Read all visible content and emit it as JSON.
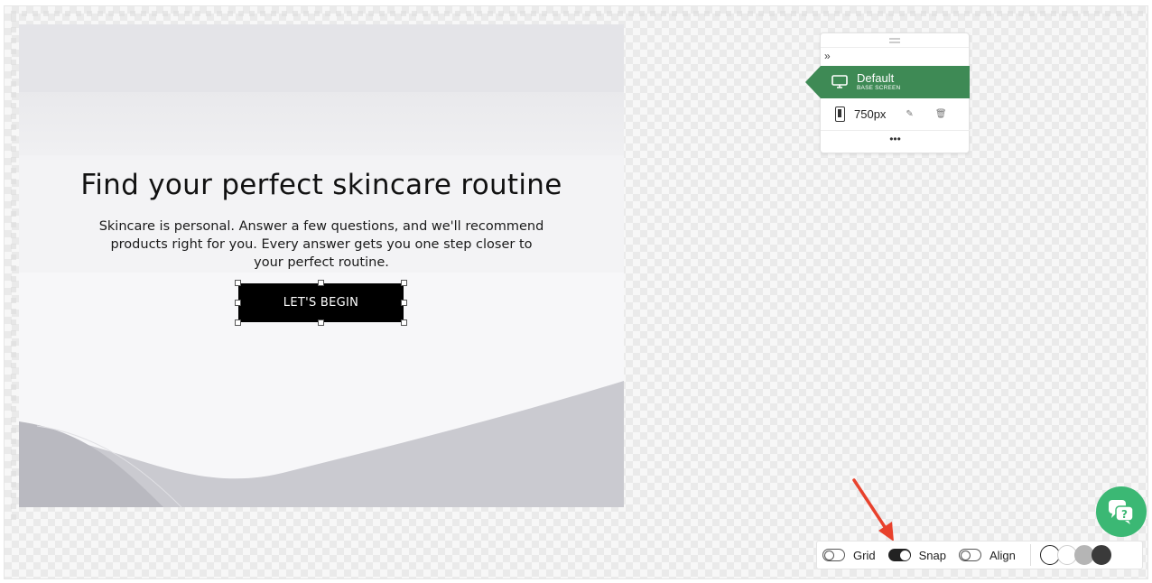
{
  "canvas": {
    "title": "Find your perfect skincare routine",
    "description": "Skincare is personal. Answer a few questions, and we'll recommend products right for you. Every answer gets you one step closer to your perfect routine.",
    "cta_label": "LET'S BEGIN"
  },
  "breakpoints": {
    "expand_glyph": "»",
    "default": {
      "label": "Default",
      "sublabel": "BASE SCREEN",
      "icon": "monitor-icon"
    },
    "items": [
      {
        "label": "750px",
        "icon": "phone-icon",
        "actions": [
          "edit-icon",
          "trash-icon"
        ]
      }
    ],
    "more_glyph": "•••"
  },
  "toolbar": {
    "grid_label": "Grid",
    "grid_on": false,
    "snap_label": "Snap",
    "snap_on": true,
    "align_label": "Align",
    "align_on": false,
    "swatches": [
      "#ffffff",
      "#ffffff",
      "#b5b5b5",
      "#3a3a3a"
    ]
  },
  "colors": {
    "accent": "#3e8a55",
    "help": "#3bb874",
    "annotation_arrow": "#e8412c"
  },
  "help_button": {
    "icon": "chat-help-icon"
  }
}
